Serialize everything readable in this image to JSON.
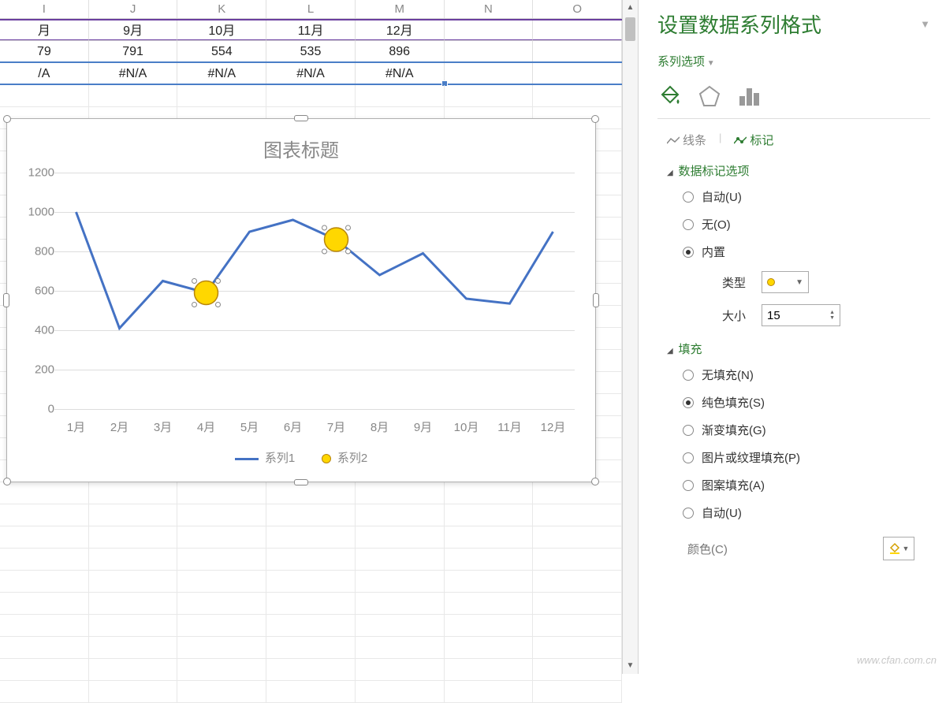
{
  "spreadsheet": {
    "columns": [
      "I",
      "J",
      "K",
      "L",
      "M",
      "N",
      "O"
    ],
    "row1": [
      "月",
      "9月",
      "10月",
      "11月",
      "12月",
      "",
      ""
    ],
    "row2": [
      "79",
      "791",
      "554",
      "535",
      "896",
      "",
      ""
    ],
    "row3": [
      "/A",
      "#N/A",
      "#N/A",
      "#N/A",
      "#N/A",
      "",
      ""
    ]
  },
  "chart_data": {
    "type": "line",
    "title": "图表标题",
    "categories": [
      "1月",
      "2月",
      "3月",
      "4月",
      "5月",
      "6月",
      "7月",
      "8月",
      "9月",
      "10月",
      "11月",
      "12月"
    ],
    "series": [
      {
        "name": "系列1",
        "values": [
          1000,
          410,
          650,
          590,
          900,
          960,
          860,
          680,
          790,
          560,
          535,
          900
        ]
      },
      {
        "name": "系列2",
        "values": [
          null,
          null,
          null,
          590,
          null,
          null,
          860,
          null,
          null,
          null,
          null,
          null
        ]
      }
    ],
    "y_ticks": [
      0,
      200,
      400,
      600,
      800,
      1000,
      1200
    ],
    "xlabel": "",
    "ylabel": "",
    "ylim": [
      0,
      1200
    ],
    "legend": [
      "系列1",
      "系列2"
    ]
  },
  "panel": {
    "title": "设置数据系列格式",
    "series_options_label": "系列选项",
    "tab_line": "线条",
    "tab_marker": "标记",
    "section_marker_options": "数据标记选项",
    "radio_auto": "自动(U)",
    "radio_none": "无(O)",
    "radio_builtin": "内置",
    "type_label": "类型",
    "size_label": "大小",
    "size_value": "15",
    "section_fill": "填充",
    "fill_none": "无填充(N)",
    "fill_solid": "纯色填充(S)",
    "fill_gradient": "渐变填充(G)",
    "fill_picture": "图片或纹理填充(P)",
    "fill_pattern": "图案填充(A)",
    "fill_auto": "自动(U)",
    "color_label": "颜色(C)"
  },
  "watermark": "www.cfan.com.cn"
}
